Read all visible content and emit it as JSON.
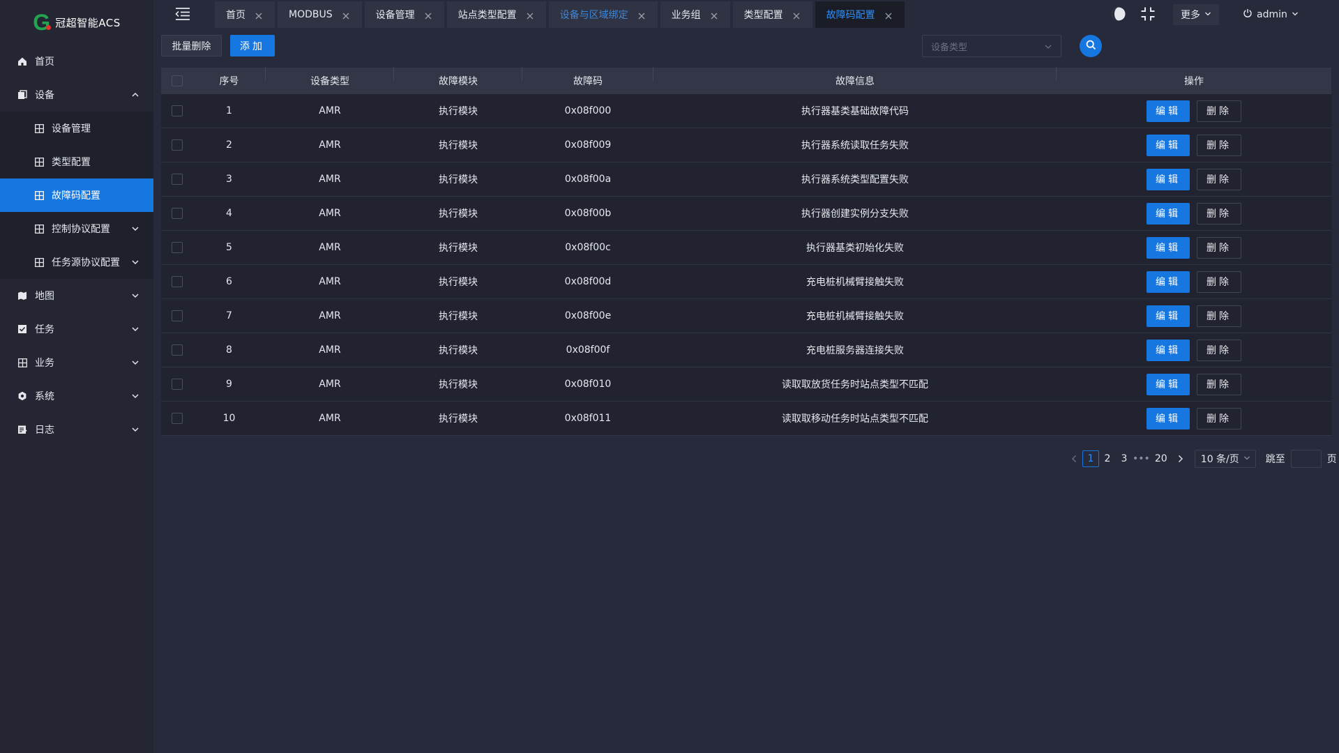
{
  "app": {
    "logo_text": "冠超智能ACS"
  },
  "sidebar": {
    "items": [
      {
        "label": "首页",
        "icon": "home-icon"
      },
      {
        "label": "设备",
        "icon": "device-icon",
        "expanded": true,
        "children": [
          {
            "label": "设备管理"
          },
          {
            "label": "类型配置"
          },
          {
            "label": "故障码配置",
            "active": true
          },
          {
            "label": "控制协议配置"
          },
          {
            "label": "任务源协议配置"
          }
        ]
      },
      {
        "label": "地图",
        "icon": "map-icon"
      },
      {
        "label": "任务",
        "icon": "task-icon"
      },
      {
        "label": "业务",
        "icon": "business-icon"
      },
      {
        "label": "系统",
        "icon": "system-icon"
      },
      {
        "label": "日志",
        "icon": "log-icon"
      }
    ]
  },
  "tabs": [
    {
      "label": "首页"
    },
    {
      "label": "MODBUS"
    },
    {
      "label": "设备管理"
    },
    {
      "label": "站点类型配置"
    },
    {
      "label": "设备与区域绑定",
      "state": "hover"
    },
    {
      "label": "业务组"
    },
    {
      "label": "类型配置"
    },
    {
      "label": "故障码配置",
      "state": "active"
    }
  ],
  "header": {
    "more_label": "更多",
    "user": "admin"
  },
  "toolbar": {
    "batch_delete_label": "批量删除",
    "add_label": "添加",
    "type_select_placeholder": "设备类型"
  },
  "table": {
    "headers": {
      "idx": "序号",
      "type": "设备类型",
      "module": "故障模块",
      "code": "故障码",
      "info": "故障信息",
      "ops": "操作"
    },
    "edit_label": "编辑",
    "delete_label": "删除",
    "rows": [
      {
        "idx": "1",
        "type": "AMR",
        "module": "执行模块",
        "code": "0x08f000",
        "info": "执行器基类基础故障代码"
      },
      {
        "idx": "2",
        "type": "AMR",
        "module": "执行模块",
        "code": "0x08f009",
        "info": "执行器系统读取任务失败"
      },
      {
        "idx": "3",
        "type": "AMR",
        "module": "执行模块",
        "code": "0x08f00a",
        "info": "执行器系统类型配置失败"
      },
      {
        "idx": "4",
        "type": "AMR",
        "module": "执行模块",
        "code": "0x08f00b",
        "info": "执行器创建实例分支失败"
      },
      {
        "idx": "5",
        "type": "AMR",
        "module": "执行模块",
        "code": "0x08f00c",
        "info": "执行器基类初始化失败"
      },
      {
        "idx": "6",
        "type": "AMR",
        "module": "执行模块",
        "code": "0x08f00d",
        "info": "充电桩机械臂接触失败"
      },
      {
        "idx": "7",
        "type": "AMR",
        "module": "执行模块",
        "code": "0x08f00e",
        "info": "充电桩机械臂接触失败"
      },
      {
        "idx": "8",
        "type": "AMR",
        "module": "执行模块",
        "code": "0x08f00f",
        "info": "充电桩服务器连接失败"
      },
      {
        "idx": "9",
        "type": "AMR",
        "module": "执行模块",
        "code": "0x08f010",
        "info": "读取取放货任务时站点类型不匹配"
      },
      {
        "idx": "10",
        "type": "AMR",
        "module": "执行模块",
        "code": "0x08f011",
        "info": "读取取移动任务时站点类型不匹配"
      }
    ]
  },
  "pagination": {
    "pages": [
      "1",
      "2",
      "3"
    ],
    "ellipsis": "•••",
    "last": "20",
    "current": "1",
    "page_size": "10 条/页",
    "jump_label": "跳至",
    "page_label": "页"
  },
  "colors": {
    "accent": "#1677e0",
    "sidebar_bg": "#242733",
    "content_bg": "#262a3a"
  }
}
